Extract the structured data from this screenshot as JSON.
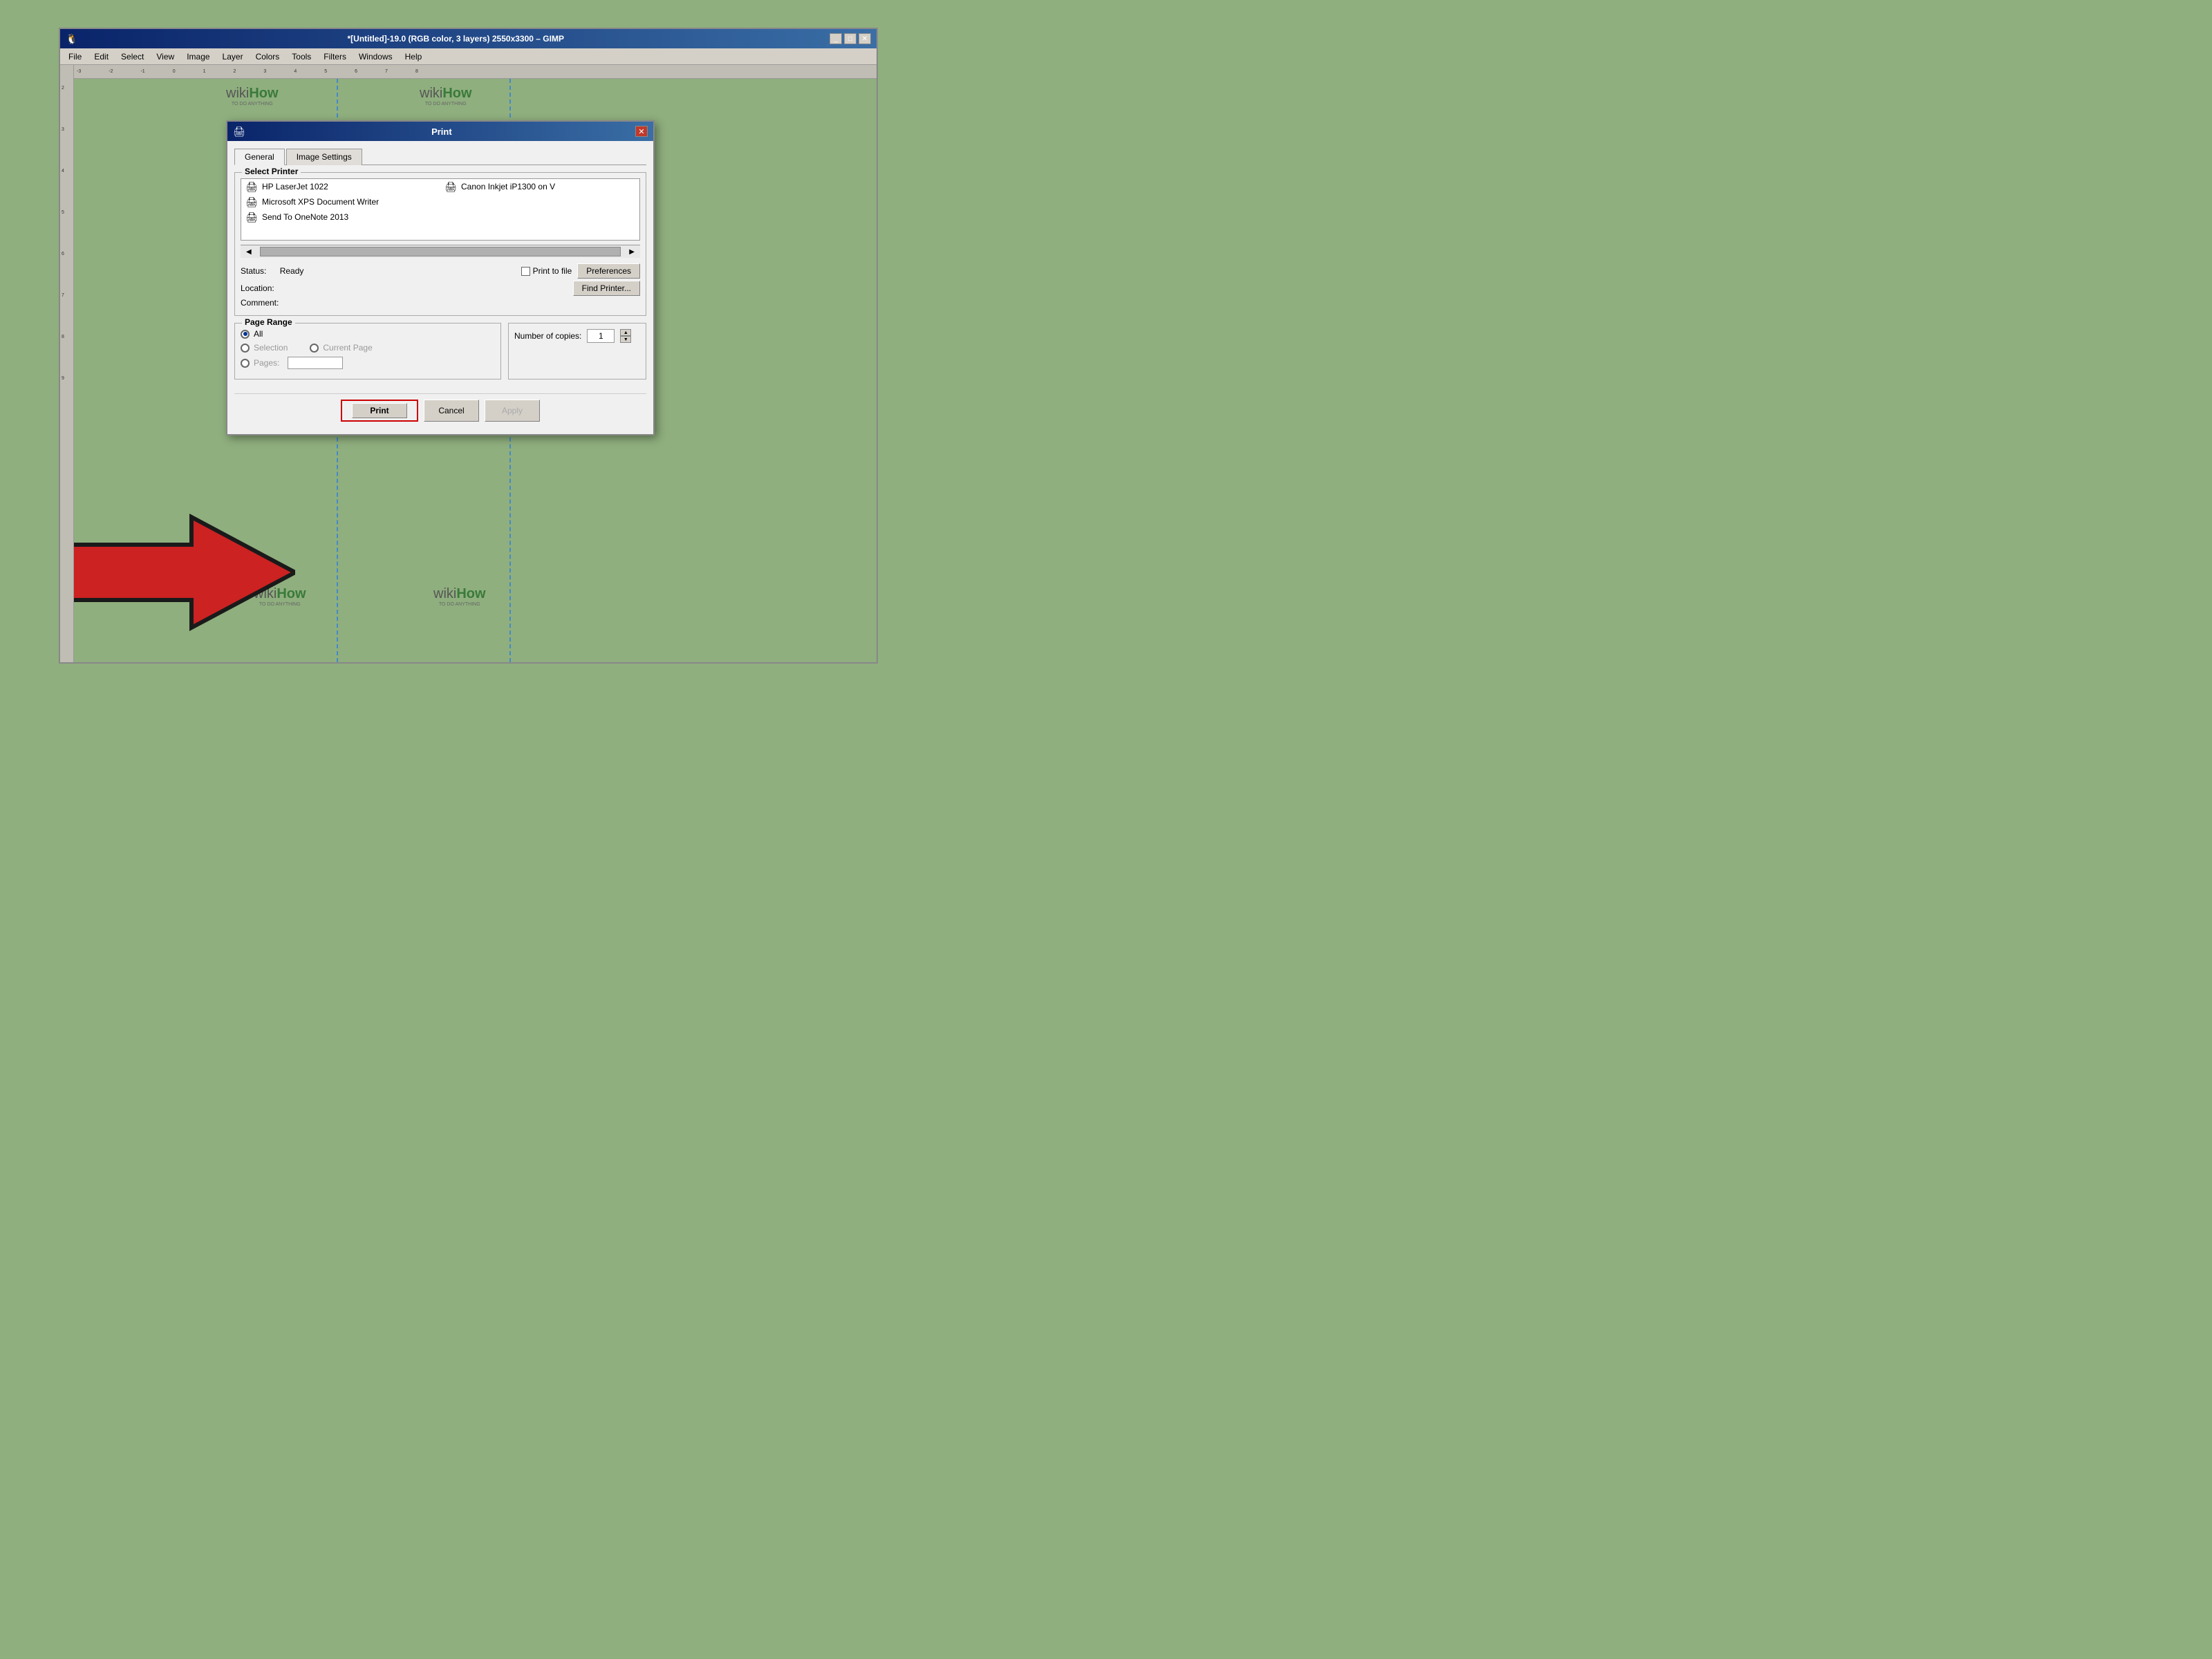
{
  "gimp": {
    "title": "*[Untitled]-19.0 (RGB color, 3 layers) 2550x3300 – GIMP",
    "menu": [
      "File",
      "Edit",
      "Select",
      "View",
      "Image",
      "Layer",
      "Colors",
      "Tools",
      "Filters",
      "Windows",
      "Help"
    ]
  },
  "print_dialog": {
    "title": "Print",
    "tabs": [
      {
        "label": "General",
        "active": true
      },
      {
        "label": "Image Settings",
        "active": false
      }
    ],
    "select_printer_label": "Select Printer",
    "printers": [
      {
        "name": "HP LaserJet 1022",
        "icon": "🖨"
      },
      {
        "name": "Canon Inkjet iP1300 on V",
        "icon": "🖨"
      },
      {
        "name": "Microsoft XPS Document Writer",
        "icon": "🖨"
      },
      {
        "name": "Send To OneNote 2013",
        "icon": "🖨"
      }
    ],
    "status_label": "Status:",
    "status_value": "Ready",
    "location_label": "Location:",
    "location_value": "",
    "comment_label": "Comment:",
    "comment_value": "",
    "print_to_file_label": "Print to file",
    "preferences_label": "Preferences",
    "find_printer_label": "Find Printer...",
    "page_range_label": "Page Range",
    "radio_all": "All",
    "radio_selection": "Selection",
    "radio_current_page": "Current Page",
    "radio_pages": "Pages:",
    "number_copies_label": "Number of copies:",
    "copies_value": "1",
    "buttons": {
      "print": "Print",
      "cancel": "Cancel",
      "apply": "Apply"
    }
  },
  "wikihow": {
    "brand": "wikiHow",
    "tagline": "TO DO ANYTHING"
  },
  "colors": {
    "background": "#8faf7e",
    "dialog_bg": "#f0f0f0",
    "title_bar_start": "#0a246a",
    "title_bar_end": "#3a6ea5",
    "close_btn": "#c0392b",
    "highlight_border": "#cc0000"
  }
}
